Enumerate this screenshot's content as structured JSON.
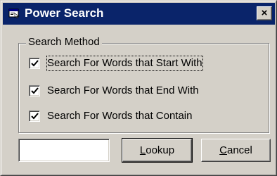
{
  "window": {
    "title": "Power Search",
    "icon": "app-search-icon",
    "close_glyph": "×"
  },
  "search_method": {
    "group_label": "Search Method",
    "options": [
      {
        "label": "Search For Words that Start With",
        "checked": true
      },
      {
        "label": "Search For Words that End With",
        "checked": true
      },
      {
        "label": "Search For Words that Contain",
        "checked": true
      }
    ]
  },
  "lookup_input": {
    "value": "",
    "placeholder": ""
  },
  "buttons": {
    "lookup": {
      "hotkey": "L",
      "rest": "ookup"
    },
    "cancel": {
      "hotkey": "C",
      "rest": "ancel"
    }
  },
  "colors": {
    "titlebar": "#0a246a",
    "face": "#d4d0c8"
  }
}
